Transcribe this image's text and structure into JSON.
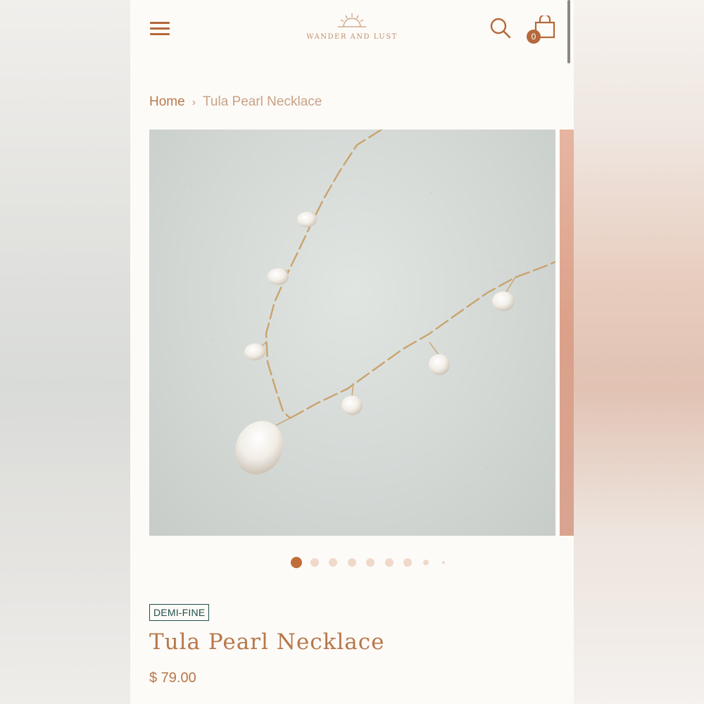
{
  "header": {
    "menu_icon": "hamburger-menu-icon",
    "logo_text": "WANDER AND LUST",
    "logo_icon": "sunrise-icon",
    "search_icon": "search-icon",
    "cart_icon": "shopping-bag-icon",
    "cart_count": "0"
  },
  "breadcrumb": {
    "home": "Home",
    "separator": "›",
    "current": "Tula Pearl Necklace"
  },
  "gallery": {
    "image_subject": "necklace-photo",
    "slide_count": 9,
    "active_slide": 1
  },
  "product": {
    "tag": "DEMI-FINE",
    "title": "Tula Pearl Necklace",
    "price": "$ 79.00"
  },
  "colors": {
    "accent": "#b5693c",
    "tag_border": "#1f4f4a",
    "background": "#fdfbf8"
  }
}
